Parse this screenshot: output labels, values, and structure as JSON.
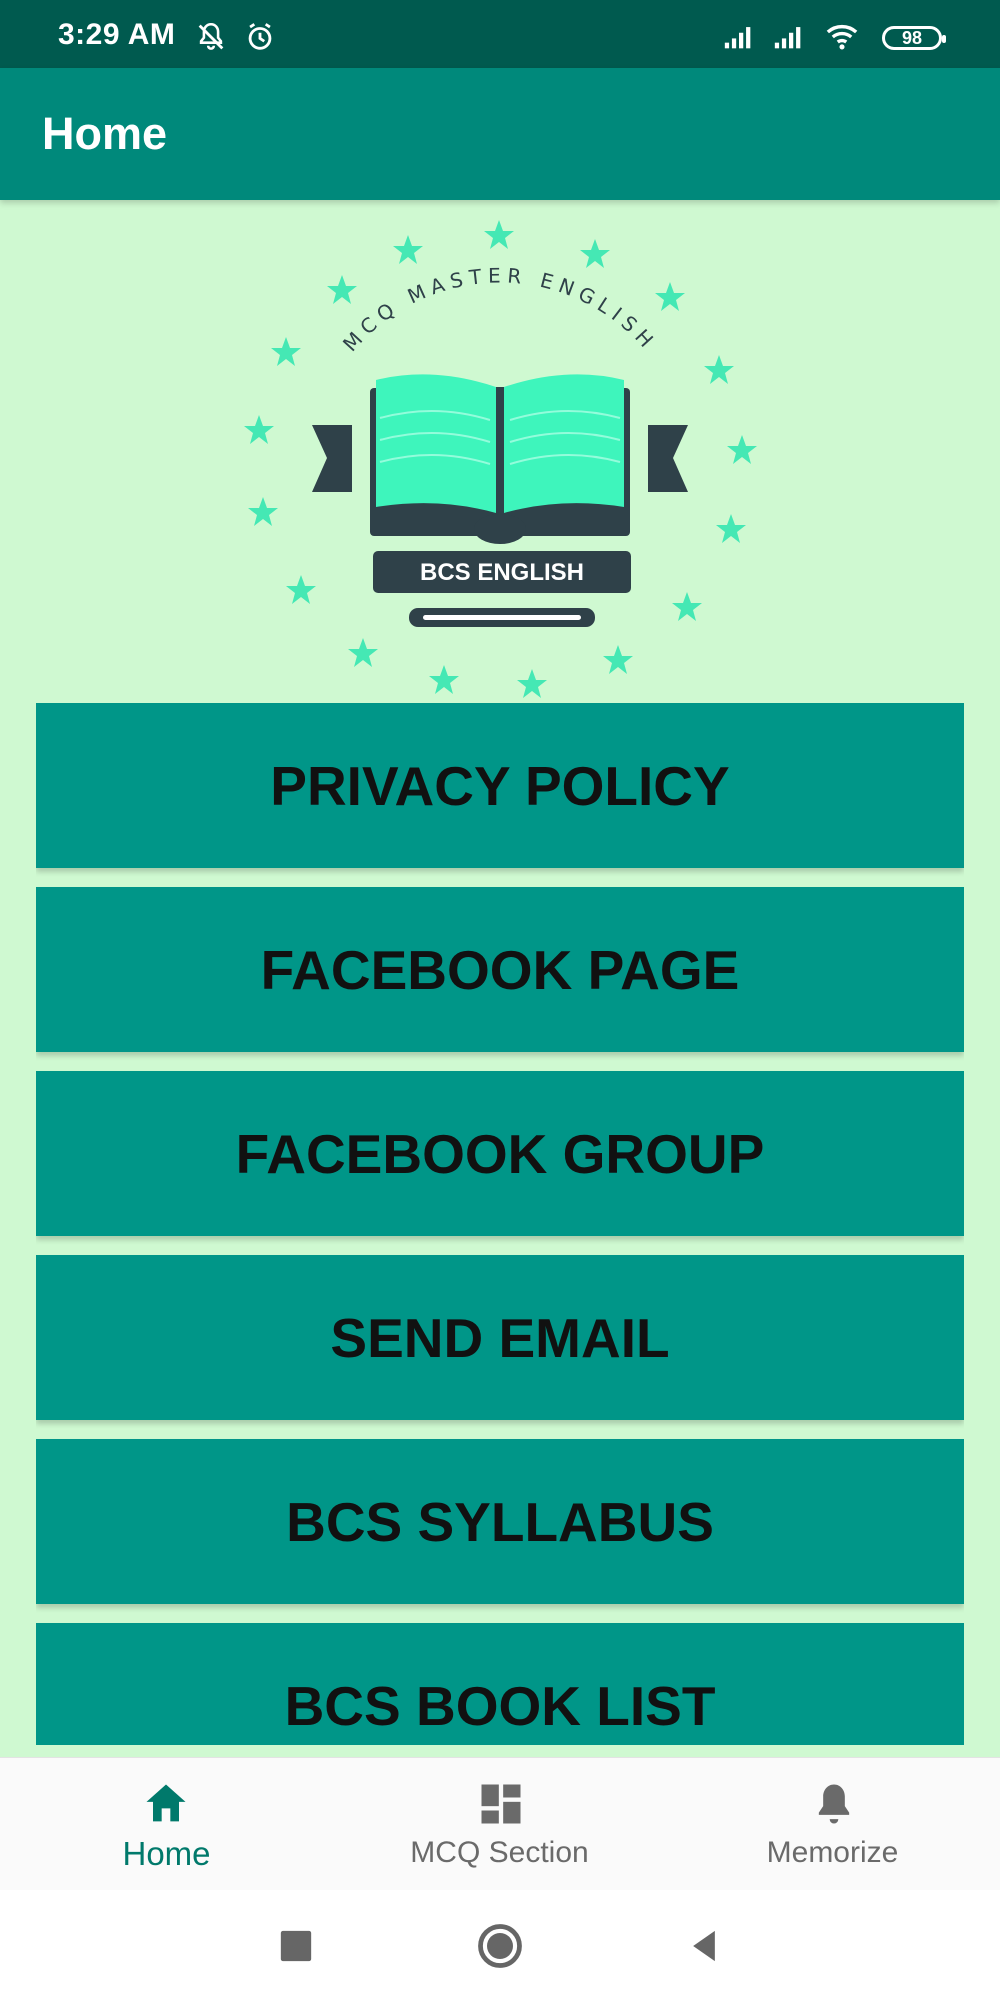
{
  "status_bar": {
    "time": "3:29 AM",
    "battery": "98",
    "icons": [
      "muted-bell-icon",
      "alarm-icon",
      "signal-icon",
      "signal-icon",
      "wifi-icon",
      "battery-icon"
    ]
  },
  "app_bar": {
    "title": "Home"
  },
  "logo": {
    "arc_text": "MCQ MASTER ENGLISH",
    "badge_text": "BCS ENGLISH",
    "colors": {
      "book": "#3ef5bc",
      "dark": "#2f4149",
      "stars": "#45e8b4"
    }
  },
  "menu": {
    "items": [
      {
        "label": "PRIVACY POLICY"
      },
      {
        "label": "FACEBOOK PAGE"
      },
      {
        "label": "FACEBOOK GROUP"
      },
      {
        "label": "SEND EMAIL"
      },
      {
        "label": "BCS SYLLABUS"
      },
      {
        "label": "BCS BOOK LIST"
      }
    ]
  },
  "bottom_nav": {
    "items": [
      {
        "label": "Home",
        "icon": "home-icon",
        "active": true
      },
      {
        "label": "MCQ Section",
        "icon": "dashboard-icon",
        "active": false
      },
      {
        "label": "Memorize",
        "icon": "bell-icon",
        "active": false
      }
    ]
  },
  "system_nav": {
    "icons": [
      "recent-apps-icon",
      "home-circle-icon",
      "back-icon"
    ]
  },
  "colors": {
    "background": "#cff9d1",
    "status_bar": "#005a4f",
    "app_bar": "#00897b",
    "button": "#009688",
    "active_nav": "#00796b"
  }
}
